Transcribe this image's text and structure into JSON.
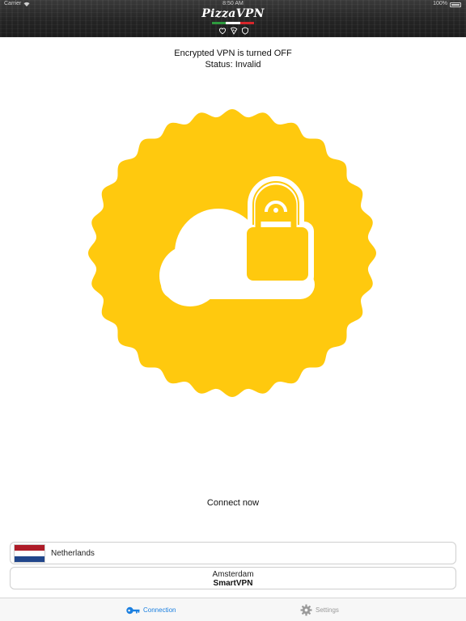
{
  "status_bar": {
    "carrier": "Carrier",
    "time": "8:50 AM",
    "battery": "100%"
  },
  "header": {
    "title": "PizzaVPN",
    "stripe_colors": [
      "#2e9a3e",
      "#ffffff",
      "#d7262b"
    ],
    "icons": [
      "heart-icon",
      "pizza-slice-icon",
      "shield-icon"
    ]
  },
  "connection_status": {
    "line1": "Encrypted VPN is turned OFF",
    "line2": "Status: Invalid"
  },
  "seal": {
    "color": "#ffc90e",
    "icon": "cloud-lock-icon"
  },
  "connect_button": {
    "label": "Connect now"
  },
  "location": {
    "country": "Netherlands",
    "flag_colors": [
      "#ae1c28",
      "#ffffff",
      "#21468b"
    ],
    "city": "Amsterdam",
    "provider": "SmartVPN"
  },
  "tab_bar": {
    "tabs": [
      {
        "label": "Connection",
        "icon": "key-icon",
        "active": true,
        "color": "#1a7fe0"
      },
      {
        "label": "Settings",
        "icon": "gear-icon",
        "active": false,
        "color": "#9a9a9a"
      }
    ]
  }
}
